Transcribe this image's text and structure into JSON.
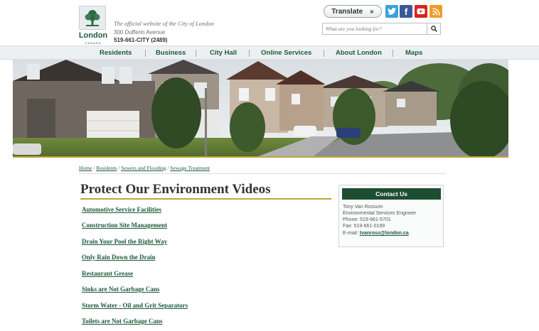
{
  "header": {
    "logo_text": "London",
    "logo_subtext": "CANADA",
    "tagline": "The official website of the City of London",
    "address": "300 Dufferin Avenue",
    "phone": "519-661-CITY (2489)",
    "translate_label": "Translate",
    "translate_chevron": "»",
    "search_placeholder": "What are you looking for?",
    "social": [
      "twitter-icon",
      "facebook-icon",
      "youtube-icon",
      "rss-icon"
    ]
  },
  "nav": {
    "items": [
      "Residents",
      "Business",
      "City Hall",
      "Online Services",
      "About London",
      "Maps"
    ]
  },
  "breadcrumb": {
    "items": [
      "Home",
      "Residents",
      "Sewers and Flooding",
      "Sewage Treatment"
    ],
    "separator": "/"
  },
  "main": {
    "title": "Protect Our Environment Videos",
    "videos": [
      "Automotive Service Facilities",
      "Construction Site Management",
      "Drain Your Pool the Right Way",
      "Only Rain Down the Drain",
      "Restaurant Grease",
      "Sinks are Not Garbage Cans",
      "Storm Water - Oil and Grit Separators",
      "Toilets are Not Garbage Cans"
    ]
  },
  "contact": {
    "heading": "Contact Us",
    "name": "Tony Van Rossum",
    "title": "Environmental Services Engineer",
    "phone": "Phone: 519-661-5701",
    "fax": "Fax: 519-661-0199",
    "email_label": "E-mail:",
    "email": "tvanross@london.ca"
  },
  "colors": {
    "brand_green": "#1d5a3a",
    "accent_gold": "#c4a43c",
    "contact_header": "#1d4d33"
  }
}
